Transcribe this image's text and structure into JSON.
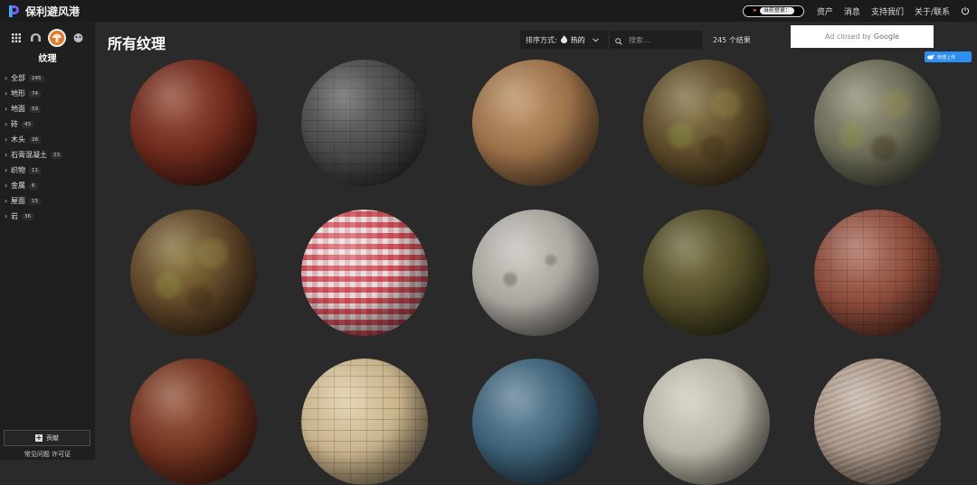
{
  "app": {
    "logo_text": "保利避风港",
    "accent_color": "#e07b2c"
  },
  "topbar": {
    "chip_label": "当前登录：",
    "links": [
      "资产",
      "消息",
      "支持我们",
      "关于/联系"
    ],
    "power_icon": "power-icon"
  },
  "sidebar": {
    "type_icons": [
      "grid-icon",
      "hdri-icon",
      "texture-icon",
      "model-icon"
    ],
    "title": "纹理",
    "categories": [
      {
        "label": "全部",
        "count": "245"
      },
      {
        "label": "地形",
        "count": "74"
      },
      {
        "label": "地面",
        "count": "59"
      },
      {
        "label": "砖",
        "count": "43"
      },
      {
        "label": "木头",
        "count": "28"
      },
      {
        "label": "石膏混凝土",
        "count": "23"
      },
      {
        "label": "织物",
        "count": "11"
      },
      {
        "label": "金属",
        "count": "6"
      },
      {
        "label": "屋面",
        "count": "15"
      },
      {
        "label": "岩",
        "count": "36"
      }
    ],
    "contribute_label": "贡献",
    "footer_text": "常见问题 许可证"
  },
  "main": {
    "title": "所有纹理",
    "sort_label": "排序方式:",
    "sort_value": "热的",
    "search_placeholder": "搜索...",
    "result_count": "245 个结果",
    "ad_text": "Ad closed by",
    "ad_brand": "Google",
    "weibo_label": "微博上传"
  },
  "textures": [
    {
      "name": "red-leather",
      "base": "#6e2a1c",
      "mid": "#8a3b27",
      "dark": "#2a0d08"
    },
    {
      "name": "stone-tiles-dark",
      "base": "#4a4a4a",
      "mid": "#5a5a58",
      "dark": "#161616"
    },
    {
      "name": "plaster-tan",
      "base": "#9a7048",
      "mid": "#b88a5c",
      "dark": "#3b2818"
    },
    {
      "name": "mossy-rock",
      "base": "#5c4a2a",
      "mid": "#7a6a38",
      "dark": "#1e170b"
    },
    {
      "name": "lichen-rock",
      "base": "#6a6a56",
      "mid": "#88876a",
      "dark": "#25251d"
    },
    {
      "name": "moss-dirt",
      "base": "#5e4528",
      "mid": "#7f6a2c",
      "dark": "#201509"
    },
    {
      "name": "red-gingham",
      "base": "#c94550",
      "mid": "#e8dcdc",
      "dark": "#4a1216"
    },
    {
      "name": "white-concrete",
      "base": "#a8a49e",
      "mid": "#c4c0b9",
      "dark": "#3d3b37"
    },
    {
      "name": "olive-fabric",
      "base": "#4f4a26",
      "mid": "#6a6433",
      "dark": "#1b190c"
    },
    {
      "name": "brick-herringbone",
      "base": "#8a4a3a",
      "mid": "#a86654",
      "dark": "#2f1711"
    },
    {
      "name": "rust-leather",
      "base": "#70321f",
      "mid": "#8f4a2e",
      "dark": "#2a0f08"
    },
    {
      "name": "cream-tiles",
      "base": "#c7b28a",
      "mid": "#dccaa0",
      "dark": "#4f4432"
    },
    {
      "name": "blue-denim",
      "base": "#3d6076",
      "mid": "#5a7e94",
      "dark": "#13212b"
    },
    {
      "name": "off-white-plaster",
      "base": "#b7b3a5",
      "mid": "#cecabc",
      "dark": "#45433b"
    },
    {
      "name": "sand-ripples",
      "base": "#a89484",
      "mid": "#c2b0a0",
      "dark": "#3f352d"
    }
  ]
}
